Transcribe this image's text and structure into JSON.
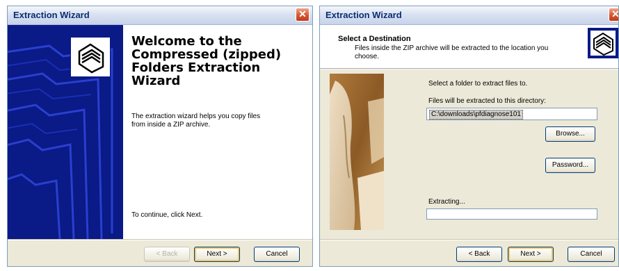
{
  "window1": {
    "title": "Extraction Wizard",
    "heading": "Welcome to the Compressed (zipped) Folders Extraction Wizard",
    "description": "The extraction wizard helps you copy files from inside a ZIP archive.",
    "continue_text": "To continue, click Next.",
    "buttons": {
      "back": "< Back",
      "next": "Next >",
      "cancel": "Cancel"
    }
  },
  "window2": {
    "title": "Extraction Wizard",
    "header_title": "Select a Destination",
    "header_subtitle": "Files inside the ZIP archive will be extracted to the location you choose.",
    "select_label": "Select a folder to extract files to.",
    "dir_label": "Files will be extracted to this directory:",
    "path_value": "C:\\downloads\\pfdiagnose101",
    "browse_label": "Browse...",
    "password_label": "Password...",
    "extracting_label": "Extracting...",
    "progress": 0,
    "buttons": {
      "back": "< Back",
      "next": "Next >",
      "cancel": "Cancel"
    }
  },
  "colors": {
    "banner": "#0a1a86",
    "title_text": "#0b2d73",
    "close": "#d8542e",
    "dialog_bg": "#ece9d8"
  }
}
